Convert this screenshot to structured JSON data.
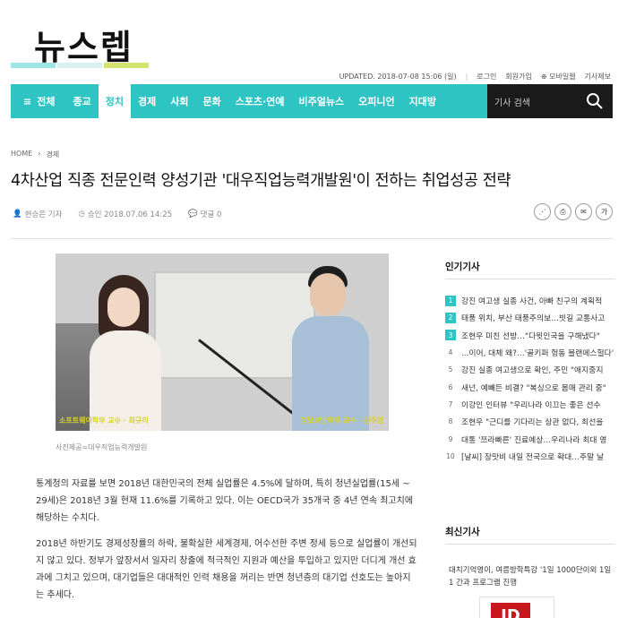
{
  "site": {
    "logo": "뉴스렙",
    "logo_bar_colors": [
      "#9ee6e6",
      "#d7f1f1",
      "#d5e36f"
    ],
    "updated": "UPDATED. 2018-07-08 15:06 (일)",
    "links": [
      "로그인",
      "회원가입",
      "모바일웹",
      "기사제보"
    ],
    "nav_all": "전체",
    "nav": [
      "종교",
      "정치",
      "경제",
      "사회",
      "문화",
      "스포츠·연예",
      "비주얼뉴스",
      "오피니언",
      "지대방"
    ],
    "nav_active_index": 1,
    "search_placeholder": "기사 검색",
    "accent": "#2ec4c4"
  },
  "article": {
    "breadcrumb": [
      "HOME",
      "경제"
    ],
    "title": "4차산업 직종 전문인력 양성기관 '대우직업능력개발원'이 전하는 취업성공 전략",
    "author": "현승은 기자",
    "approved": "승인 2018.07.06 14:25",
    "comments": "댓글 0",
    "photo_caption_left": "소프트웨어학부 교수 · 최규리",
    "photo_caption_right": "정보보안학부 교수 · 김주영",
    "photo_credit": "사진제공=대우직업능력개발원",
    "paragraphs": [
      "통계청의 자료를 보면 2018년 대한민국의 전체 실업률은 4.5%에 달하며, 특히 청년실업률(15세 ~ 29세)은 2018년 3월 현재 11.6%를 기록하고 있다. 이는 OECD국가 35개국 중 4년 연속 최고치에 해당하는 수치다.",
      "2018년 하반기도 경제성장률의 하락, 불확실한 세계경제, 어수선한 주변 정세 등으로 실업률이 개선되지 않고 있다. 정부가 앞장서서 일자리 창출에 적극적인 지원과 예산을 투입하고 있지만 더디게 개선 효과에 그치고 있으며, 대기업들은 대대적인 인력 채용을 꺼리는 반면 청년층의 대기업 선호도는 높아지는 추세다."
    ]
  },
  "sidebar": {
    "popular_title": "인기기사",
    "popular": [
      "강진 여고생 실종 사건, 아빠 친구의 계획적",
      "태풍 위치, 부산 태풍주의보…빗길 교통사고",
      "조현우 미친 선방…\"다윗인국을 구해냈다\"",
      "...이어, 대체 왜?…'골키퍼 헝동 블랜에스헐다'",
      "강진 실종 여고생으로 확인, 주민 \"애지중지",
      "새넌, 예빼든 비결? \"복싱으로 몸매 관리 중\"",
      "이강인 인터뷰 \"우리나라 이끄는 좋은 선수",
      "조현우 \"근디를 기다리는 상관 없다, 최선을",
      "대통 '쯔라빠른' 진료예상…우리나라 최대 영",
      "[날씨] 장맛비 내일 전국으로 확대…주말 날"
    ],
    "latest_title": "최신기사",
    "latest": [
      "대치기억영이, 여름방학특강 '1일 1000단이외 1일 1 간과 프로그램 진행"
    ],
    "thumb_logo": "JD"
  }
}
